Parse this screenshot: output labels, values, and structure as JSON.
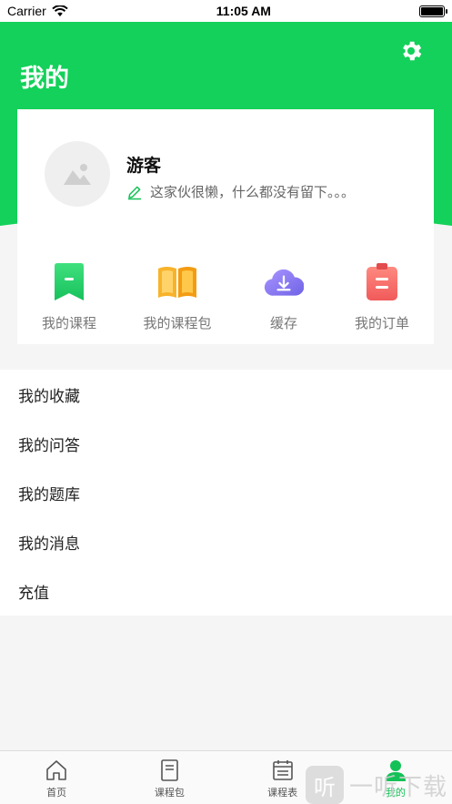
{
  "status_bar": {
    "carrier": "Carrier",
    "time": "11:05 AM"
  },
  "header": {
    "title": "我的",
    "settings_icon": "gear-icon"
  },
  "profile": {
    "name": "游客",
    "signature": "这家伙很懒，什么都没有留下。。。"
  },
  "quick_actions": [
    {
      "label": "我的课程",
      "icon": "bookmark-icon",
      "color": "#2bd36d"
    },
    {
      "label": "我的课程包",
      "icon": "open-book-icon",
      "color": "#f5a623"
    },
    {
      "label": "缓存",
      "icon": "cloud-download-icon",
      "color": "#8d7cf0"
    },
    {
      "label": "我的订单",
      "icon": "clipboard-icon",
      "color": "#f46b6b"
    }
  ],
  "menu": [
    {
      "label": "我的收藏"
    },
    {
      "label": "我的问答"
    },
    {
      "label": "我的题库"
    },
    {
      "label": "我的消息"
    },
    {
      "label": "充值"
    }
  ],
  "tabs": [
    {
      "label": "首页",
      "icon": "home-icon",
      "active": false
    },
    {
      "label": "课程包",
      "icon": "book-icon",
      "active": false
    },
    {
      "label": "课程表",
      "icon": "calendar-icon",
      "active": false
    },
    {
      "label": "我的",
      "icon": "person-icon",
      "active": true
    }
  ],
  "watermark": {
    "text": "一听下载",
    "glyph": "听"
  },
  "colors": {
    "brand": "#13d15a",
    "active_tab": "#13c157"
  }
}
